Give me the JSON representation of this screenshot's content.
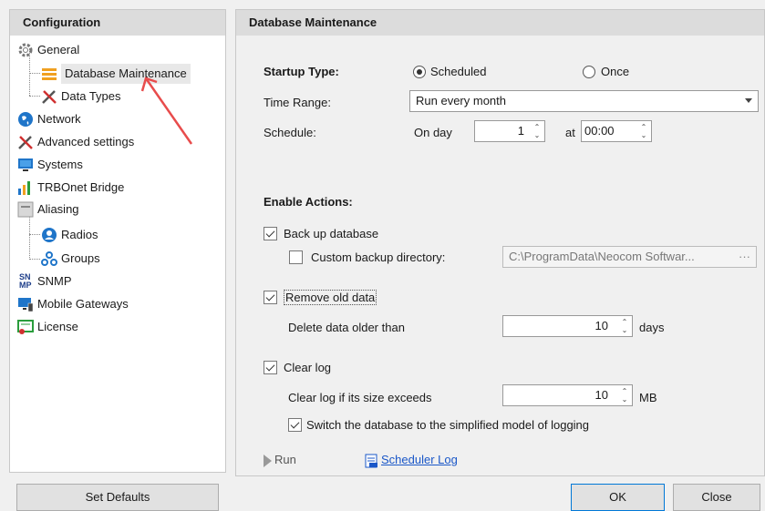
{
  "left_panel": {
    "header": "Configuration",
    "items": [
      {
        "label": "General",
        "icon": "gear-icon"
      },
      {
        "label": "Database Maintenance",
        "icon": "list-lines-icon"
      },
      {
        "label": "Data Types",
        "icon": "tools-icon"
      },
      {
        "label": "Network",
        "icon": "globe-icon"
      },
      {
        "label": "Advanced settings",
        "icon": "tools-icon"
      },
      {
        "label": "Systems",
        "icon": "monitor-icon"
      },
      {
        "label": "TRBOnet Bridge",
        "icon": "bars-icon"
      },
      {
        "label": "Aliasing",
        "icon": "window-icon"
      },
      {
        "label": "Radios",
        "icon": "user-circle-icon"
      },
      {
        "label": "Groups",
        "icon": "group-icon"
      },
      {
        "label": "SNMP",
        "icon": "snmp-icon"
      },
      {
        "label": "Mobile Gateways",
        "icon": "monitor-phone-icon"
      },
      {
        "label": "License",
        "icon": "license-icon"
      }
    ],
    "snmp_icon_text": [
      "SN",
      "MP"
    ]
  },
  "right_panel": {
    "header": "Database Maintenance",
    "startup_type_label": "Startup Type:",
    "scheduled_label": "Scheduled",
    "once_label": "Once",
    "startup_selected": "Scheduled",
    "time_range_label": "Time Range:",
    "time_range_value": "Run every month",
    "schedule_label": "Schedule:",
    "on_day_label": "On day",
    "day_value": "1",
    "at_label": "at",
    "time_value": "00:00",
    "enable_actions_label": "Enable Actions:",
    "backup_label": "Back up database",
    "backup_checked": true,
    "custom_dir_label": "Custom backup directory:",
    "custom_dir_checked": false,
    "custom_dir_value": "C:\\ProgramData\\Neocom Softwar...",
    "custom_dir_browse": "···",
    "remove_old_label": "Remove old data",
    "remove_old_checked": true,
    "delete_older_label": "Delete data older than",
    "delete_older_value": "10",
    "days_label": "days",
    "clear_log_label": "Clear log",
    "clear_log_checked": true,
    "clear_log_size_label": "Clear log if its size exceeds",
    "clear_log_size_value": "10",
    "mb_label": "MB",
    "switch_db_label": "Switch the database to the simplified model of logging",
    "switch_db_checked": true,
    "run_label": "Run",
    "scheduler_log_label": "Scheduler Log"
  },
  "footer": {
    "set_defaults_label": "Set Defaults",
    "ok_label": "OK",
    "close_label": "Close"
  },
  "colors": {
    "header_bg": "#dcdcdc",
    "accent": "#0078d7",
    "link": "#1a57c8",
    "annotation_arrow": "#e84c4c"
  }
}
